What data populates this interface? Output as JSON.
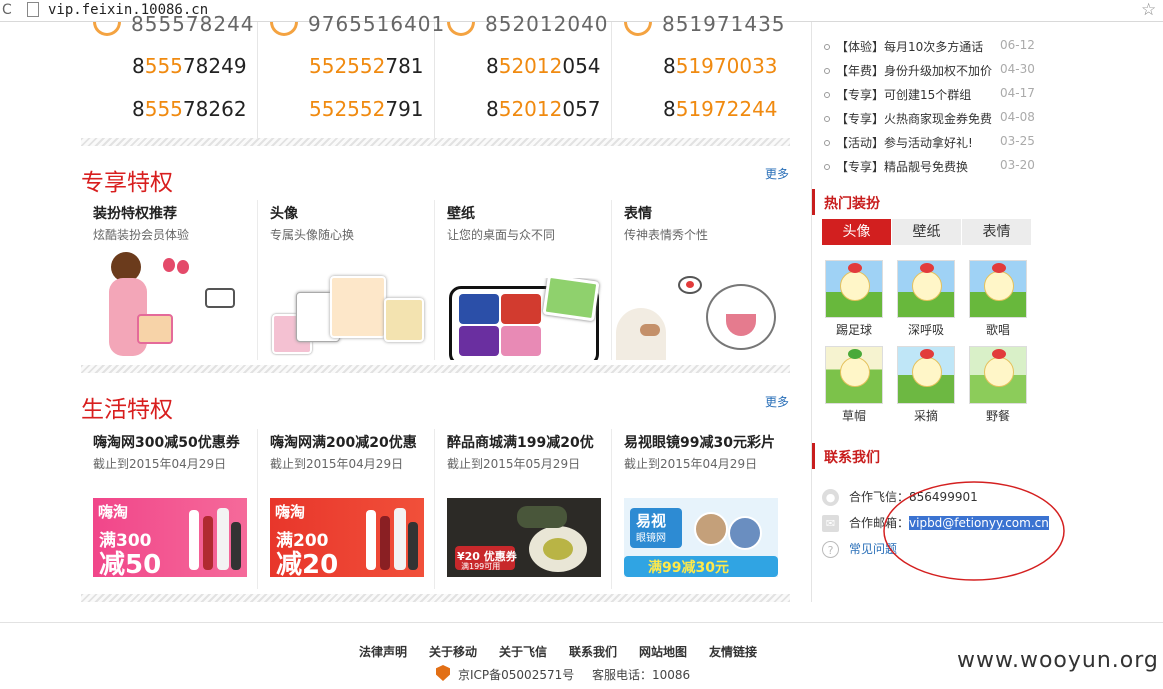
{
  "browser": {
    "url": "vip.feixin.10086.cn",
    "refresh_icon": "refresh-icon",
    "bookmark_icon": "star-icon"
  },
  "numbers": {
    "cut_row": [
      "855578244",
      "9765516401",
      "852012040",
      "851971435"
    ],
    "rows": [
      [
        {
          "prefix": "8",
          "hl": "555",
          "suffix": "78249"
        },
        {
          "prefix": "",
          "hl": "552552",
          "suffix": "781"
        },
        {
          "prefix": "8",
          "hl": "52012",
          "suffix": "054"
        },
        {
          "prefix": "8",
          "hl": "51970033",
          "suffix": ""
        }
      ],
      [
        {
          "prefix": "8",
          "hl": "555",
          "suffix": "78262"
        },
        {
          "prefix": "",
          "hl": "552552",
          "suffix": "791"
        },
        {
          "prefix": "8",
          "hl": "52012",
          "suffix": "057"
        },
        {
          "prefix": "8",
          "hl": "51972244",
          "suffix": ""
        }
      ]
    ]
  },
  "exclusive": {
    "title": "专享特权",
    "more": "更多",
    "cards": [
      {
        "title": "装扮特权推荐",
        "sub": "炫酷装扮会员体验"
      },
      {
        "title": "头像",
        "sub": "专属头像随心换"
      },
      {
        "title": "壁纸",
        "sub": "让您的桌面与众不同"
      },
      {
        "title": "表情",
        "sub": "传神表情秀个性"
      }
    ]
  },
  "life": {
    "title": "生活特权",
    "more": "更多",
    "cards": [
      {
        "title": "嗨淘网300减50优惠券",
        "sub": "截止到2015年04月29日",
        "ad_big": "满300",
        "ad_big2": "减50",
        "brand": "嗨淘"
      },
      {
        "title": "嗨淘网满200减20优惠",
        "sub": "截止到2015年04月29日",
        "ad_big": "满200",
        "ad_big2": "减20",
        "brand": "嗨淘"
      },
      {
        "title": "醉品商城满199减20优",
        "sub": "截止到2015年05月29日",
        "ad_big": "¥20 优惠券",
        "ad_big2": "满199可用",
        "brand": ""
      },
      {
        "title": "易视眼镜99减30元彩片",
        "sub": "截止到2015年04月29日",
        "ad_big": "易视",
        "ad_big2": "满99减30元",
        "brand": "眼镜网"
      }
    ]
  },
  "sidebar": {
    "news": [
      {
        "text": "【体验】每月10次多方通话",
        "date": "06-12"
      },
      {
        "text": "【年费】身份升级加权不加价",
        "date": "04-30"
      },
      {
        "text": "【专享】可创建15个群组",
        "date": "04-17"
      },
      {
        "text": "【专享】火热商家现金券免费",
        "date": "04-08"
      },
      {
        "text": "【活动】参与活动拿好礼!",
        "date": "03-25"
      },
      {
        "text": "【专享】精品靓号免费换",
        "date": "03-20"
      }
    ],
    "hot_title": "热门装扮",
    "tabs": [
      "头像",
      "壁纸",
      "表情"
    ],
    "emoticons": [
      "踢足球",
      "深呼吸",
      "歌唱",
      "草帽",
      "采摘",
      "野餐"
    ],
    "contact_title": "联系我们",
    "contact": {
      "fetion_label": "合作飞信：",
      "fetion_value": "856499901",
      "email_label": "合作邮箱：",
      "email_value": "vipbd@fetionyy.com.cn",
      "faq": "常见问题"
    }
  },
  "footer": {
    "links": [
      "法律声明",
      "关于移动",
      "关于飞信",
      "联系我们",
      "网站地图",
      "友情链接"
    ],
    "icp": "京ICP备05002571号",
    "service": "客服电话：10086"
  },
  "watermark": "www.wooyun.org",
  "colors": {
    "accent_red": "#d81e1e",
    "number_orange": "#f08a10",
    "link_blue": "#2a6fb8",
    "annotation_red": "#d42020"
  }
}
